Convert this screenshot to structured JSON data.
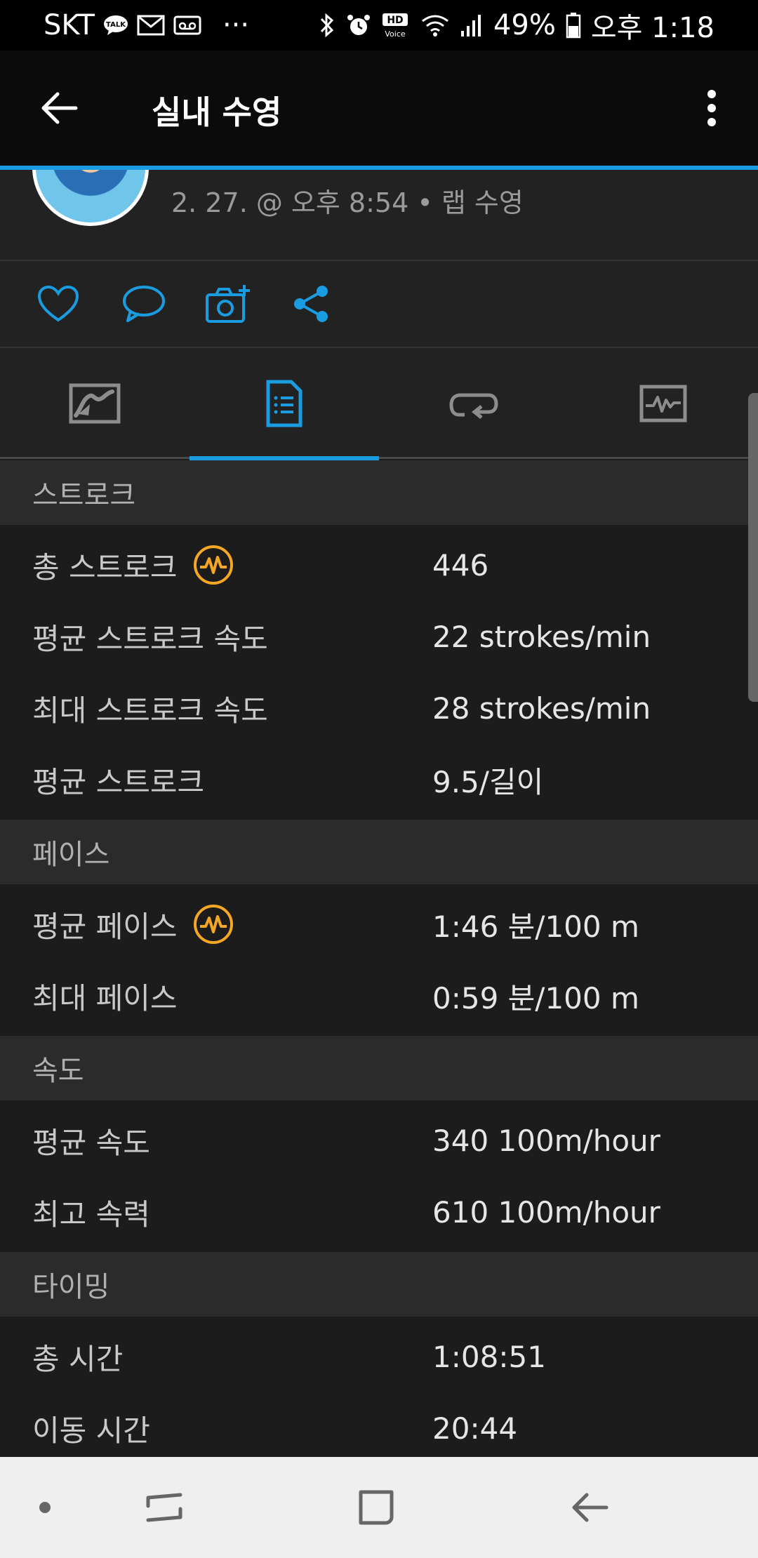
{
  "status_bar": {
    "carrier": "SKT",
    "talk_badge": "TALK",
    "more": "···",
    "hd_label": "HD",
    "voice_label": "Voice",
    "battery": "49%",
    "time": "오후 1:18"
  },
  "app_bar": {
    "title": "실내 수영"
  },
  "activity": {
    "subtitle": "2. 27. @ 오후 8:54 • 랩 수영"
  },
  "sections": [
    {
      "title": "스트로크",
      "rows": [
        {
          "label": "총 스트로크",
          "value": "446"
        },
        {
          "label": "평균 스트로크 속도",
          "value": "22 strokes/min"
        },
        {
          "label": "최대 스트로크 속도",
          "value": "28 strokes/min"
        },
        {
          "label": "평균 스트로크",
          "value": "9.5/길이"
        }
      ]
    },
    {
      "title": "페이스",
      "rows": [
        {
          "label": "평균 페이스",
          "value": "1:46 분/100 m"
        },
        {
          "label": "최대 페이스",
          "value": "0:59 분/100 m"
        }
      ]
    },
    {
      "title": "속도",
      "rows": [
        {
          "label": "평균 속도",
          "value": "340 100m/hour"
        },
        {
          "label": "최고 속력",
          "value": "610 100m/hour"
        }
      ]
    },
    {
      "title": "타이밍",
      "rows": [
        {
          "label": "총 시간",
          "value": "1:08:51"
        },
        {
          "label": "이동 시간",
          "value": "20:44"
        }
      ]
    }
  ],
  "colors": {
    "accent": "#1a9ce0",
    "badge": "#f5a623"
  },
  "icons": {
    "tabs": [
      "map-icon",
      "details-document-icon",
      "laps-loop-icon",
      "chart-icon"
    ],
    "actions": [
      "heart-icon",
      "comment-icon",
      "camera-add-icon",
      "share-icon"
    ]
  }
}
